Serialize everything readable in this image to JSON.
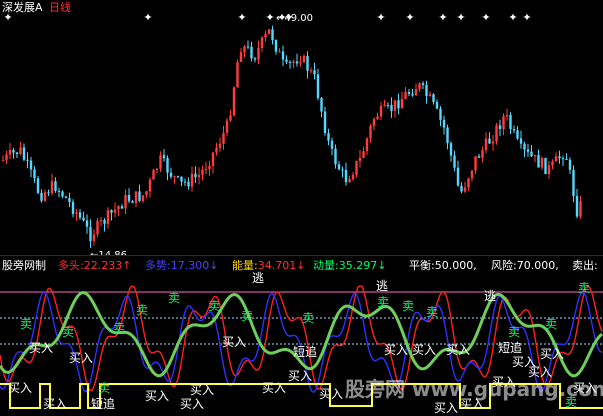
{
  "header": {
    "stock_name": "深发展A",
    "period": "日线",
    "colors": {
      "stock_name": "#ffffff",
      "period": "#ff3030"
    }
  },
  "price_chart": {
    "high_marker": "49.00",
    "low_marker": "14.86",
    "extreme_marker_glyph": "←",
    "signal_glyph": "✦",
    "colors": {
      "up": "#ff3c3c",
      "down": "#54d8ff",
      "signal": "#ffffff",
      "marker": "#ffffff"
    }
  },
  "indicator": {
    "name": "股旁网制",
    "legend": [
      {
        "key": "duotou",
        "label": "多头:",
        "value": "22.233",
        "arrow": "↑",
        "color": "#ff3030",
        "value_color": "#ff3030"
      },
      {
        "key": "duoshi",
        "label": "多势:",
        "value": "17.300",
        "arrow": "↓",
        "color": "#4444ff",
        "value_color": "#4444ff"
      },
      {
        "key": "nengliang",
        "label": "能量:",
        "value": "34.701",
        "arrow": "↓",
        "color": "#ffd700",
        "value_color": "#ff3030"
      },
      {
        "key": "dongliang",
        "label": "动量:",
        "value": "35.297",
        "arrow": "↓",
        "color": "#00ff66",
        "value_color": "#00ff66"
      },
      {
        "key": "pingheng",
        "label": "平衡:",
        "value": "50.000",
        "arrow": ",",
        "color": "#ffffff",
        "value_color": "#ffffff"
      },
      {
        "key": "fengxian",
        "label": "风险:",
        "value": "70.000",
        "arrow": ",",
        "color": "#ffffff",
        "value_color": "#ffffff"
      },
      {
        "key": "maichu",
        "label": "卖出:",
        "value": "",
        "arrow": "",
        "color": "#ffffff",
        "value_color": "#ffffff"
      }
    ],
    "labels": {
      "buy": "买入",
      "sell": "卖",
      "escape": "逃",
      "short": "短追",
      "sell_green": "卖"
    },
    "watermark": "股旁网 www.gupang.com",
    "colors": {
      "duotou": "#ff2020",
      "duoshi": "#3030ff",
      "dongliang": "#6ecf5a",
      "box": "#ffff40",
      "ref_line": "#ff6ac1",
      "ref_line2": "#a0e0ff"
    }
  }
}
